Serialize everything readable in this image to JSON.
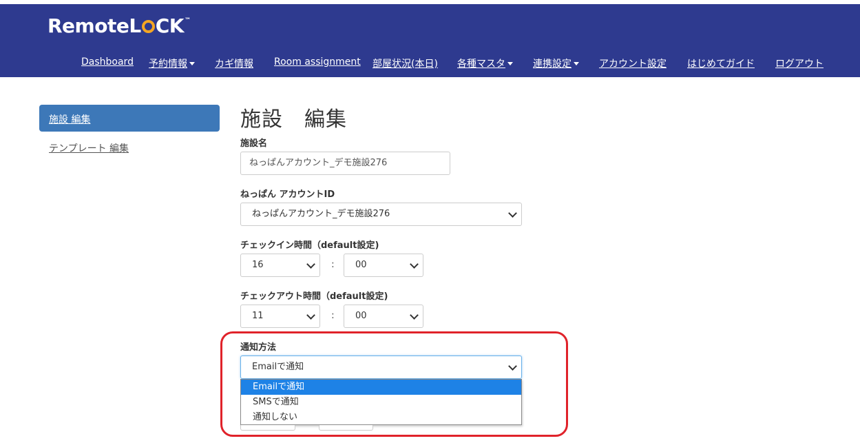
{
  "brand": {
    "name_part1": "Remote",
    "name_part2a": "L",
    "name_part2b": "CK",
    "trademark": "™"
  },
  "nav": {
    "items": [
      {
        "label": "Dashboard",
        "dropdown": false
      },
      {
        "label": "予約情報",
        "dropdown": true
      },
      {
        "label": "カギ情報",
        "dropdown": false
      },
      {
        "label": "Room assignment",
        "dropdown": false
      },
      {
        "label": "部屋状況(本日)",
        "dropdown": false
      },
      {
        "label": "各種マスタ",
        "dropdown": true
      },
      {
        "label": "連携設定",
        "dropdown": true
      },
      {
        "label": "アカウント設定",
        "dropdown": false
      },
      {
        "label": "はじめてガイド",
        "dropdown": false
      },
      {
        "label": "ログアウト",
        "dropdown": false
      }
    ]
  },
  "sidebar": {
    "items": [
      {
        "label": "施設 編集",
        "active": true
      },
      {
        "label": "テンプレート 編集",
        "active": false
      }
    ]
  },
  "page": {
    "title": "施設　編集",
    "facility_name_label": "施設名",
    "facility_name_value": "ねっぱんアカウント_デモ施設276",
    "account_id_label": "ねっぱん アカウントID",
    "account_id_value": "ねっぱんアカウント_デモ施設276",
    "checkin_label": "チェックイン時間（default設定)",
    "checkin_hour": "16",
    "checkin_minute": "00",
    "checkout_label": "チェックアウト時間（default設定)",
    "checkout_hour": "11",
    "checkout_minute": "00",
    "time_separator": ":",
    "notify_label": "通知方法",
    "notify_value": "Emailで通知",
    "notify_options": [
      "Emailで通知",
      "SMSで通知",
      "通知しない"
    ]
  },
  "colors": {
    "header_bg": "#2e3a8f",
    "sidebar_active": "#3d78b8",
    "option_selected": "#1e82e6",
    "highlight_border": "#e0222a"
  }
}
